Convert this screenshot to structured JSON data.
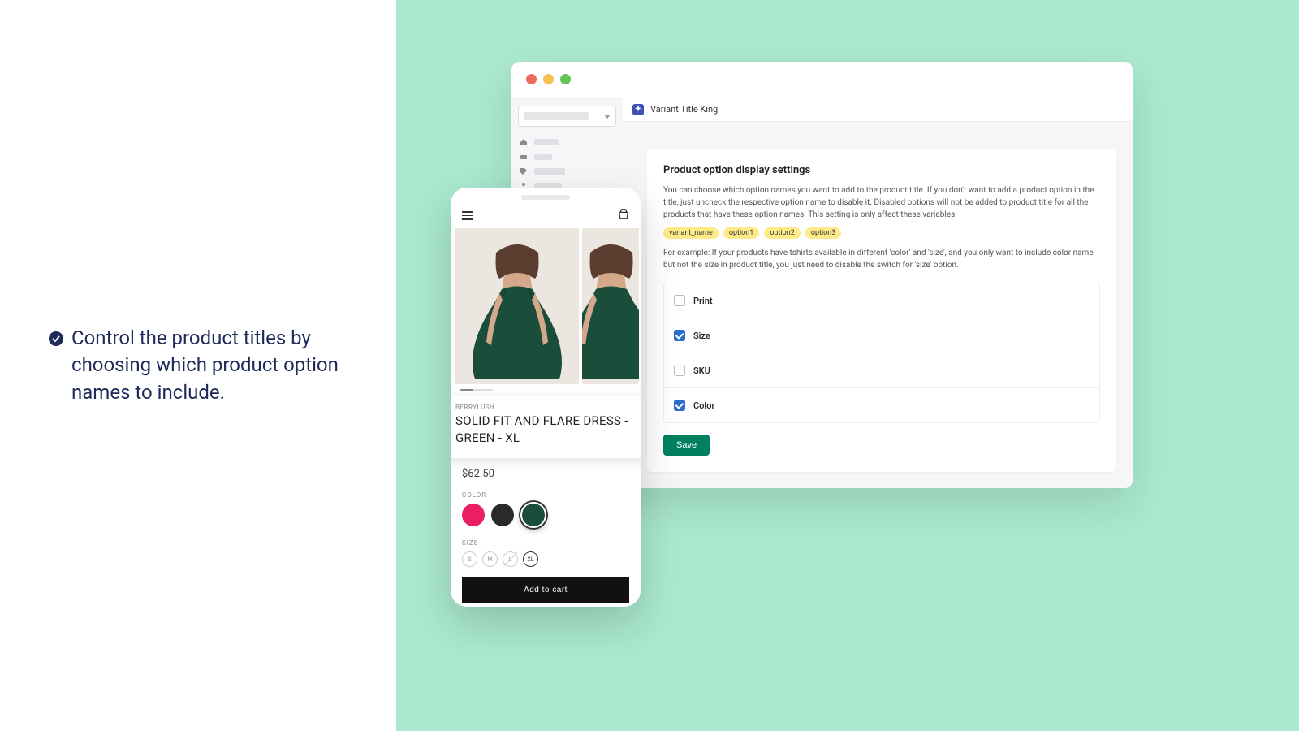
{
  "headline": "Control the product titles by choosing which product option names to include.",
  "app": {
    "title": "Variant Title King",
    "card": {
      "heading": "Product option display settings",
      "description": "You can choose which option names you want to add to the product title. If you don't want to add a product option in the title, just uncheck the respective option name to disable it. Disabled options will not be added to product title for all the products that have these option names. This setting is only affect these variables.",
      "tags": [
        "variant_name",
        "option1",
        "option2",
        "option3"
      ],
      "example": "For example: If your products have tshirts available in different 'color' and 'size', and you only want to include color name but not the size in product title, you just need to disable the switch for 'size' option.",
      "options": [
        {
          "label": "Print",
          "checked": false
        },
        {
          "label": "Size",
          "checked": true
        },
        {
          "label": "SKU",
          "checked": false
        },
        {
          "label": "Color",
          "checked": true
        }
      ],
      "save_label": "Save"
    }
  },
  "product": {
    "brand": "BERRYLUSH",
    "title": "SOLID FIT AND FLARE DRESS - GREEN - XL",
    "price": "$62.50",
    "color_label": "COLOR",
    "colors": [
      "pink",
      "black",
      "green"
    ],
    "selected_color": "green",
    "size_label": "SIZE",
    "sizes": [
      {
        "label": "S",
        "available": true,
        "selected": false
      },
      {
        "label": "M",
        "available": true,
        "selected": false
      },
      {
        "label": "L",
        "available": false,
        "selected": false
      },
      {
        "label": "XL",
        "available": true,
        "selected": true
      }
    ],
    "cta": "Add to cart"
  }
}
